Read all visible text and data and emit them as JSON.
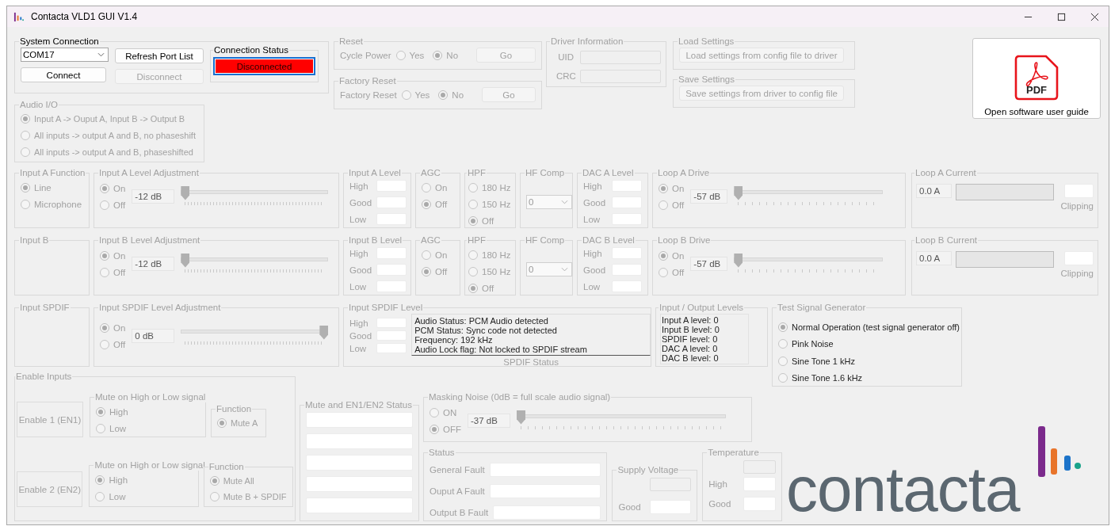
{
  "window": {
    "title": "Contacta VLD1 GUI V1.4"
  },
  "system_connection": {
    "title": "System Connection",
    "disabled": false,
    "port": "COM17",
    "refresh": {
      "label": "Refresh Port List",
      "disabled": false
    },
    "connect": {
      "label": "Connect",
      "disabled": false
    },
    "disconnect": {
      "label": "Disconnect",
      "disabled": true
    },
    "status": {
      "title": "Connection Status",
      "value": "Disconnected",
      "connected": false
    }
  },
  "audio_io": {
    "title": "Audio I/O",
    "disabled": true,
    "options": [
      {
        "label": "Input A -> Ouput A, Input B -> Output B",
        "selected": true
      },
      {
        "label": "All inputs -> output A and B, no phaseshift",
        "selected": false
      },
      {
        "label": "All inputs -> output A and B, phaseshifted",
        "selected": false
      }
    ]
  },
  "reset": {
    "title": "Reset",
    "disabled": true,
    "label": "Cycle Power",
    "options": [
      {
        "label": "Yes",
        "selected": false
      },
      {
        "label": "No",
        "selected": true
      }
    ],
    "button": "Go"
  },
  "factory_reset": {
    "title": "Factory Reset",
    "disabled": true,
    "label": "Factory Reset",
    "options": [
      {
        "label": "Yes",
        "selected": false
      },
      {
        "label": "No",
        "selected": true
      }
    ],
    "button": "Go"
  },
  "driver_information": {
    "title": "Driver Information",
    "disabled": true,
    "fields": [
      "UID",
      "CRC"
    ]
  },
  "load_settings": {
    "title": "Load Settings",
    "disabled": true,
    "button": "Load settings from config file to driver"
  },
  "save_settings": {
    "title": "Save Settings",
    "disabled": true,
    "button": "Save settings from driver to config file"
  },
  "user_guide": {
    "icon_label": "PDF",
    "label": "Open software user guide"
  },
  "channels": [
    {
      "function": {
        "title": "Input A Function",
        "disabled": true,
        "options": [
          {
            "label": "Line",
            "selected": true
          },
          {
            "label": "Microphone",
            "selected": false
          }
        ]
      },
      "level_adjustment": {
        "title": "Input A Level Adjustment",
        "disabled": true,
        "options": [
          {
            "label": "On",
            "selected": true
          },
          {
            "label": "Off",
            "selected": false
          }
        ],
        "reading": "-12 dB",
        "level": 0
      },
      "input_level": {
        "title": "Input A Level",
        "disabled": true,
        "labels": [
          "High",
          "Good",
          "Low"
        ]
      },
      "agc": {
        "title": "AGC",
        "disabled": true,
        "options": [
          {
            "label": "On",
            "selected": false
          },
          {
            "label": "Off",
            "selected": true
          }
        ]
      },
      "hpf": {
        "title": "HPF",
        "disabled": true,
        "options": [
          {
            "label": "180 Hz",
            "selected": false
          },
          {
            "label": "150 Hz",
            "selected": false
          },
          {
            "label": "Off",
            "selected": true
          }
        ]
      },
      "hf_comp": {
        "title": "HF Comp",
        "disabled": true,
        "value": "0"
      },
      "dac_level": {
        "title": "DAC A Level",
        "disabled": true,
        "labels": [
          "High",
          "Good",
          "Low"
        ]
      },
      "loop_drive": {
        "title": "Loop A Drive",
        "disabled": true,
        "options": [
          {
            "label": "On",
            "selected": true
          },
          {
            "label": "Off",
            "selected": false
          }
        ],
        "reading": "-57 dB",
        "level": 0
      },
      "loop_current": {
        "title": "Loop A Current",
        "disabled": true,
        "reading": "0.0 A",
        "clipping": "Clipping"
      }
    },
    {
      "function": {
        "title": "Input B",
        "disabled": true
      },
      "level_adjustment": {
        "title": "Input B Level Adjustment",
        "disabled": true,
        "options": [
          {
            "label": "On",
            "selected": true
          },
          {
            "label": "Off",
            "selected": false
          }
        ],
        "reading": "-12 dB",
        "level": 0
      },
      "input_level": {
        "title": "Input B Level",
        "disabled": true,
        "labels": [
          "High",
          "Good",
          "Low"
        ]
      },
      "agc": {
        "title": "AGC",
        "disabled": true,
        "options": [
          {
            "label": "On",
            "selected": false
          },
          {
            "label": "Off",
            "selected": true
          }
        ]
      },
      "hpf": {
        "title": "HPF",
        "disabled": true,
        "options": [
          {
            "label": "180 Hz",
            "selected": false
          },
          {
            "label": "150 Hz",
            "selected": false
          },
          {
            "label": "Off",
            "selected": true
          }
        ]
      },
      "hf_comp": {
        "title": "HF Comp",
        "disabled": true,
        "value": "0"
      },
      "dac_level": {
        "title": "DAC B Level",
        "disabled": true,
        "labels": [
          "High",
          "Good",
          "Low"
        ]
      },
      "loop_drive": {
        "title": "Loop B Drive",
        "disabled": true,
        "options": [
          {
            "label": "On",
            "selected": true
          },
          {
            "label": "Off",
            "selected": false
          }
        ],
        "reading": "-57 dB",
        "level": 0
      },
      "loop_current": {
        "title": "Loop B Current",
        "disabled": true,
        "reading": "0.0 A",
        "clipping": "Clipping"
      }
    }
  ],
  "spdif": {
    "function": {
      "title": "Input SPDIF",
      "disabled": true
    },
    "level_adjustment": {
      "title": "Input SPDIF Level Adjustment",
      "disabled": true,
      "options": [
        {
          "label": "On",
          "selected": true
        },
        {
          "label": "Off",
          "selected": false
        }
      ],
      "reading": "0 dB",
      "level": 1
    },
    "input_level": {
      "title": "Input SPDIF Level",
      "disabled": true,
      "labels": [
        "High",
        "Good",
        "Low"
      ],
      "status_lines": [
        "Audio Status: PCM Audio detected",
        "PCM Status: Sync code not detected",
        "Frequency: 192 kHz",
        "Audio Lock flag: Not locked to SPDIF stream"
      ],
      "status_caption": "SPDIF Status"
    }
  },
  "io_levels": {
    "title": "Input / Output Levels",
    "disabled": true,
    "lines": [
      "Input A level: 0",
      "Input B level: 0",
      "SPDIF level: 0",
      "DAC A level: 0",
      "DAC B level: 0"
    ]
  },
  "test_signal": {
    "title": "Test Signal Generator",
    "disabled": false,
    "options": [
      {
        "label": "Normal Operation (test signal generator off)",
        "selected": true
      },
      {
        "label": "Pink Noise",
        "selected": false
      },
      {
        "label": "Sine Tone 1 kHz",
        "selected": false
      },
      {
        "label": "Sine Tone 1.6 kHz",
        "selected": false
      }
    ]
  },
  "enable_inputs": {
    "title": "Enable Inputs",
    "disabled": true,
    "rows": [
      {
        "label": "Enable 1 (EN1)",
        "mute": {
          "title": "Mute on High or Low signal",
          "options": [
            {
              "label": "High",
              "selected": true
            },
            {
              "label": "Low",
              "selected": false
            }
          ]
        },
        "function": {
          "title": "Function",
          "options": [
            {
              "label": "Mute A",
              "selected": true
            }
          ]
        }
      },
      {
        "label": "Enable 2 (EN2)",
        "mute": {
          "title": "Mute on High or Low signal",
          "options": [
            {
              "label": "High",
              "selected": true
            },
            {
              "label": "Low",
              "selected": false
            }
          ]
        },
        "function": {
          "title": "Function",
          "options": [
            {
              "label": "Mute All",
              "selected": true
            },
            {
              "label": "Mute B + SPDIF",
              "selected": false
            }
          ]
        }
      }
    ]
  },
  "mute_status": {
    "title": "Mute and EN1/EN2 Status",
    "disabled": true
  },
  "masking_noise": {
    "title": "Masking Noise (0dB = full scale audio signal)",
    "disabled": true,
    "options": [
      {
        "label": "ON",
        "selected": false
      },
      {
        "label": "OFF",
        "selected": true
      }
    ],
    "reading": "-37 dB",
    "level": 0
  },
  "status": {
    "title": "Status",
    "disabled": true,
    "fields": [
      "General Fault",
      "Ouput A Fault",
      "Output B Fault"
    ]
  },
  "supply_voltage": {
    "title": "Supply Voltage",
    "disabled": true,
    "label": "Good"
  },
  "temperature": {
    "title": "Temperature",
    "disabled": true,
    "labels": [
      "High",
      "Good"
    ]
  },
  "logo": {
    "text": "contacta"
  }
}
